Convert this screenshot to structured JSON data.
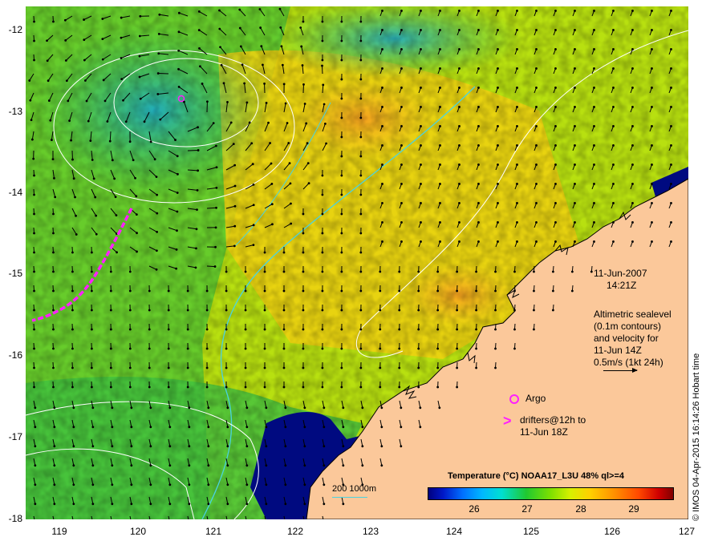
{
  "map": {
    "y_ticks": [
      "-12",
      "-13",
      "-14",
      "-15",
      "-16",
      "-17",
      "-18"
    ],
    "x_ticks": [
      "119",
      "120",
      "121",
      "122",
      "123",
      "124",
      "125",
      "126",
      "127"
    ],
    "lat_range": [
      -18,
      -11.75
    ],
    "lon_range": [
      118.65,
      127
    ]
  },
  "annotations": {
    "date": "11-Jun-2007",
    "time": "14:21Z",
    "altimetry_lines": [
      "Altimetric sealevel",
      "(0.1m contours)",
      "and velocity for",
      "11-Jun 14Z",
      "0.5m/s (1kt 24h)"
    ],
    "argo_label": "Argo",
    "drifters_lines": [
      "drifters@12h to",
      "11-Jun 18Z"
    ]
  },
  "colorbar": {
    "title": "Temperature (°C) NOAA17_L3U 48% ql>=4",
    "labels": [
      "26",
      "27",
      "28",
      "29"
    ]
  },
  "scale": {
    "label": "200  1000m"
  },
  "credit": "© IMOS 04-Apr-2015 16:14:26 Hobart time",
  "colors": {
    "land": "#fbc89a",
    "deep_water": "#000a80",
    "contour": "#ffffff",
    "isobath": "#4ad3e0",
    "drifter": "#ff20ff"
  },
  "icons": [
    "velocity-arrow-icon",
    "argo-float-icon",
    "drifter-track-icon"
  ]
}
